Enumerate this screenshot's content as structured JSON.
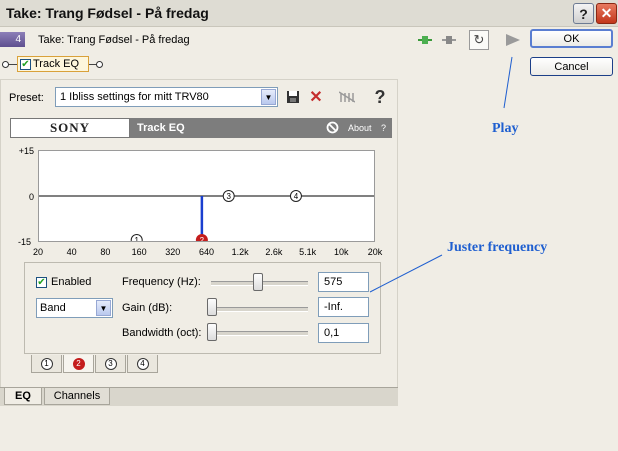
{
  "window": {
    "title": "Take: Trang Fødsel - På fredag",
    "help_glyph": "?",
    "close_glyph": "✕"
  },
  "take": {
    "number": "4",
    "label": "Take: Trang Fødsel - På fredag"
  },
  "buttons": {
    "ok": "OK",
    "cancel": "Cancel"
  },
  "chain": {
    "plugin_label": "Track EQ",
    "enabled": true
  },
  "preset": {
    "label": "Preset:",
    "value": "1 Ibliss settings for mitt TRV80",
    "help": "?"
  },
  "header": {
    "brand": "SONY",
    "title": "Track EQ",
    "about": "About",
    "about_help": "?"
  },
  "graph": {
    "y_labels": [
      "+15",
      "0",
      "-15"
    ],
    "x_labels": [
      "20",
      "40",
      "80",
      "160",
      "320",
      "640",
      "1.2k",
      "2.6k",
      "5.1k",
      "10k",
      "20k"
    ],
    "band_markers": [
      {
        "label": "1",
        "freq_hz": 150,
        "gain_db": -15,
        "active": false
      },
      {
        "label": "2",
        "freq_hz": 575,
        "gain_db": -15,
        "active": true
      },
      {
        "label": "3",
        "freq_hz": 1000,
        "gain_db": 0,
        "active": false
      },
      {
        "label": "4",
        "freq_hz": 4000,
        "gain_db": 0,
        "active": false
      }
    ],
    "curve_color": "#1a3fcf"
  },
  "controls": {
    "enabled_label": "Enabled",
    "enabled": true,
    "band_type": "Band",
    "frequency_label": "Frequency (Hz):",
    "frequency_value": "575",
    "gain_label": "Gain (dB):",
    "gain_value": "-Inf.",
    "bandwidth_label": "Bandwidth (oct):",
    "bandwidth_value": "0,1"
  },
  "band_tabs": [
    {
      "label": "1",
      "active": false
    },
    {
      "label": "2",
      "active": true
    },
    {
      "label": "3",
      "active": false
    },
    {
      "label": "4",
      "active": false
    }
  ],
  "bottom_tabs": [
    {
      "label": "EQ",
      "active": true
    },
    {
      "label": "Channels",
      "active": false
    }
  ],
  "annotations": {
    "play": "Play",
    "frequency": "Juster frequency"
  },
  "colors": {
    "annotation": "#1f5fd0",
    "active_band": "#c41d1d",
    "header_band": "#7d7d7d"
  }
}
